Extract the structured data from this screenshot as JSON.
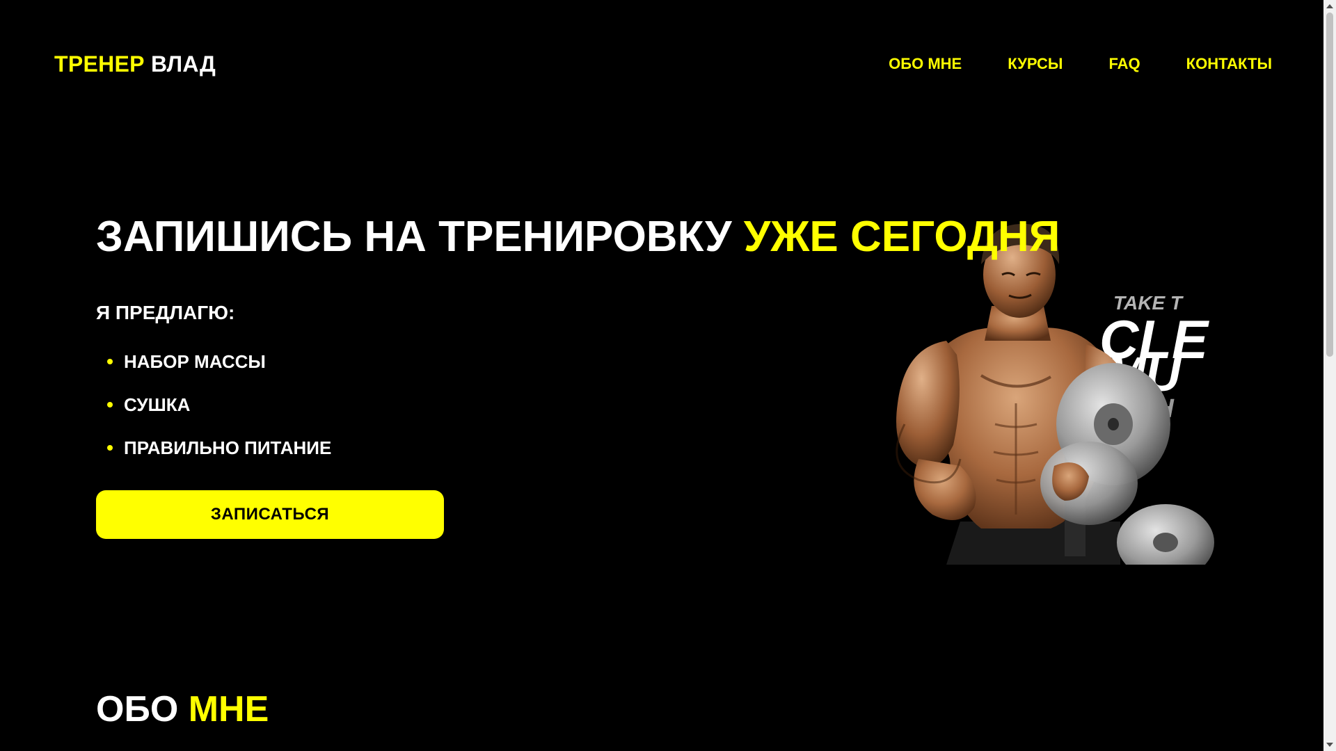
{
  "header": {
    "logo_part1": "ТРЕНЕР",
    "logo_part2": "ВЛАД",
    "nav": [
      {
        "label": "ОБО МНЕ"
      },
      {
        "label": "КУРСЫ"
      },
      {
        "label": "FAQ"
      },
      {
        "label": "КОНТАКТЫ"
      }
    ]
  },
  "hero": {
    "title_white": "ЗАПИШИСЬ НА ТРЕНИРОВКУ",
    "title_yellow": "УЖЕ СЕГОДНЯ",
    "offer_heading": "Я ПРЕДЛАГЮ:",
    "offers": [
      "НАБОР МАССЫ",
      "СУШКА",
      "ПРАВИЛЬНО ПИТАНИЕ"
    ],
    "cta_label": "ЗАПИСАТЬСЯ",
    "image_text": [
      "TAKE T",
      "CLE",
      "MU",
      "CH"
    ]
  },
  "about": {
    "title_white": "ОБО",
    "title_yellow": "МНЕ"
  },
  "colors": {
    "background": "#000000",
    "accent": "#ffff00",
    "text": "#ffffff"
  }
}
